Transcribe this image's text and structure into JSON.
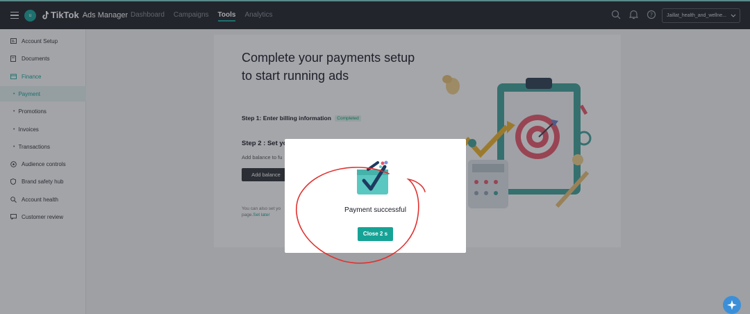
{
  "header": {
    "avatar_letter": "u",
    "logo_brand": "TikTok",
    "logo_product": "Ads Manager",
    "nav": [
      "Dashboard",
      "Campaigns",
      "Tools",
      "Analytics"
    ],
    "active_nav": "Tools",
    "account_name": "Jaillat_health_and_wellne..."
  },
  "sidebar": {
    "items": [
      {
        "label": "Account Setup",
        "icon": "id-card-icon"
      },
      {
        "label": "Documents",
        "icon": "document-icon"
      },
      {
        "label": "Finance",
        "icon": "wallet-icon"
      },
      {
        "label": "Payment",
        "sub": true,
        "selected": true
      },
      {
        "label": "Promotions",
        "sub": true
      },
      {
        "label": "Invoices",
        "sub": true
      },
      {
        "label": "Transactions",
        "sub": true
      },
      {
        "label": "Audience controls",
        "icon": "audience-icon"
      },
      {
        "label": "Brand safety hub",
        "icon": "shield-icon"
      },
      {
        "label": "Account health",
        "icon": "health-icon"
      },
      {
        "label": "Customer review",
        "icon": "review-icon"
      }
    ]
  },
  "main": {
    "title": "Complete your payments setup to start running ads",
    "step1_label": "Step 1: Enter billing information",
    "step1_status": "Completed",
    "step2_label": "Step 2 : Set yo",
    "add_balance_text": "Add balance to fu",
    "add_balance_button": "Add balance",
    "later_text_line1": "You can also set yo",
    "later_text_prefix": "page.",
    "later_link": "Set later"
  },
  "modal": {
    "message": "Payment successful",
    "close_button": "Close 2 s"
  },
  "colors": {
    "accent": "#16a396",
    "topbar": "#1f2226",
    "annotation": "#e0312f"
  }
}
